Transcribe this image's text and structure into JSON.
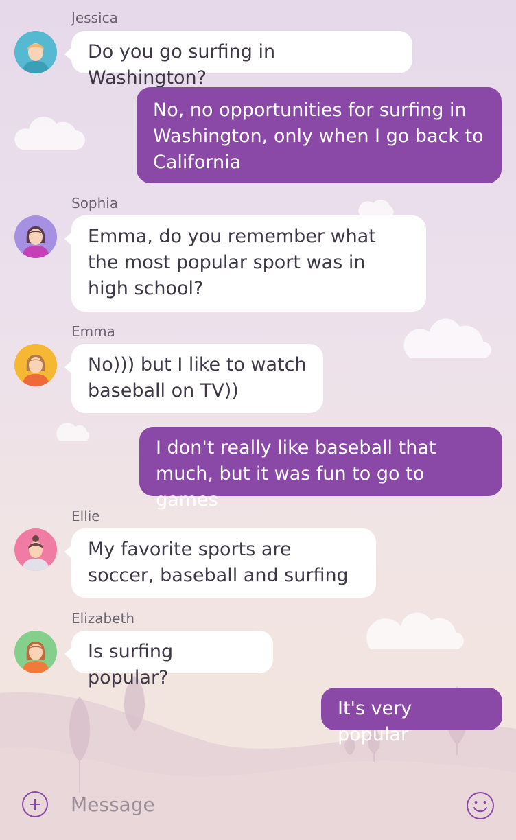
{
  "composer": {
    "placeholder": "Message",
    "add_icon": "plus-circle-icon",
    "emoji_icon": "smiley-icon"
  },
  "messages": [
    {
      "side": "incoming",
      "sender": "Jessica",
      "avatar_color": "#55b9d2",
      "text": "Do you go surfing in Washington?"
    },
    {
      "side": "outgoing",
      "text": "No, no opportunities for surfing in Washington, only when I go back to California"
    },
    {
      "side": "incoming",
      "sender": "Sophia",
      "avatar_color": "#a590e2",
      "text": "Emma, do you remember what the most popular sport was in high school?"
    },
    {
      "side": "incoming",
      "sender": "Emma",
      "avatar_color": "#f6b732",
      "text": "No))) but I like to watch baseball on TV))"
    },
    {
      "side": "outgoing",
      "text": "I don't really like baseball that much, but it was fun to go to games"
    },
    {
      "side": "incoming",
      "sender": "Ellie",
      "avatar_color": "#f07ca3",
      "text": "My favorite sports are soccer, baseball and surfing"
    },
    {
      "side": "incoming",
      "sender": "Elizabeth",
      "avatar_color": "#84cf8c",
      "text": "Is surfing popular?"
    },
    {
      "side": "outgoing",
      "text": "It's very popular"
    }
  ],
  "colors": {
    "accent": "#8a49a6",
    "incoming_bubble": "#ffffff",
    "text": "#3e3745"
  }
}
